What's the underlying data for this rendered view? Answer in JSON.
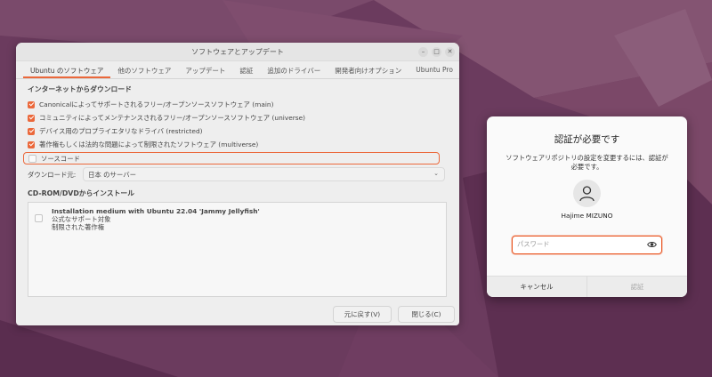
{
  "window": {
    "title": "ソフトウェアとアップデート",
    "tabs": [
      {
        "label": "Ubuntu のソフトウェア",
        "active": true
      },
      {
        "label": "他のソフトウェア"
      },
      {
        "label": "アップデート"
      },
      {
        "label": "認証"
      },
      {
        "label": "追加のドライバー"
      },
      {
        "label": "開発者向けオプション"
      },
      {
        "label": "Ubuntu Pro"
      }
    ],
    "download_section": {
      "title": "インターネットからダウンロード",
      "items": [
        {
          "label": "Canonicalによってサポートされるフリー/オープンソースソフトウェア (main)",
          "checked": true
        },
        {
          "label": "コミュニティによってメンテナンスされるフリー/オープンソースソフトウェア (universe)",
          "checked": true
        },
        {
          "label": "デバイス用のプロプライエタリなドライバ (restricted)",
          "checked": true
        },
        {
          "label": "著作権もしくは法的な問題によって制限されたソフトウェア (multiverse)",
          "checked": true
        },
        {
          "label": "ソースコード",
          "checked": false
        }
      ],
      "download_from_label": "ダウンロード元:",
      "download_from_value": "日本 のサーバー"
    },
    "cdrom_section": {
      "title": "CD-ROM/DVDからインストール",
      "item": {
        "title": "Installation medium with Ubuntu 22.04 'Jammy Jellyfish'",
        "line1": "公式なサポート対象",
        "line2": "制限された著作権",
        "checked": false
      }
    },
    "buttons": {
      "revert": "元に戻す(V)",
      "close": "閉じる(C)"
    }
  },
  "auth_dialog": {
    "heading": "認証が必要です",
    "message_line1": "ソフトウェアリポジトリの設定を変更するには、認証が",
    "message_line2": "必要です。",
    "user_name": "Hajime MIZUNO",
    "password_placeholder": "パスワード",
    "cancel_label": "キャンセル",
    "authenticate_label": "認証"
  },
  "colors": {
    "accent": "#e95420",
    "wallpaper": "#6a3a5c"
  }
}
